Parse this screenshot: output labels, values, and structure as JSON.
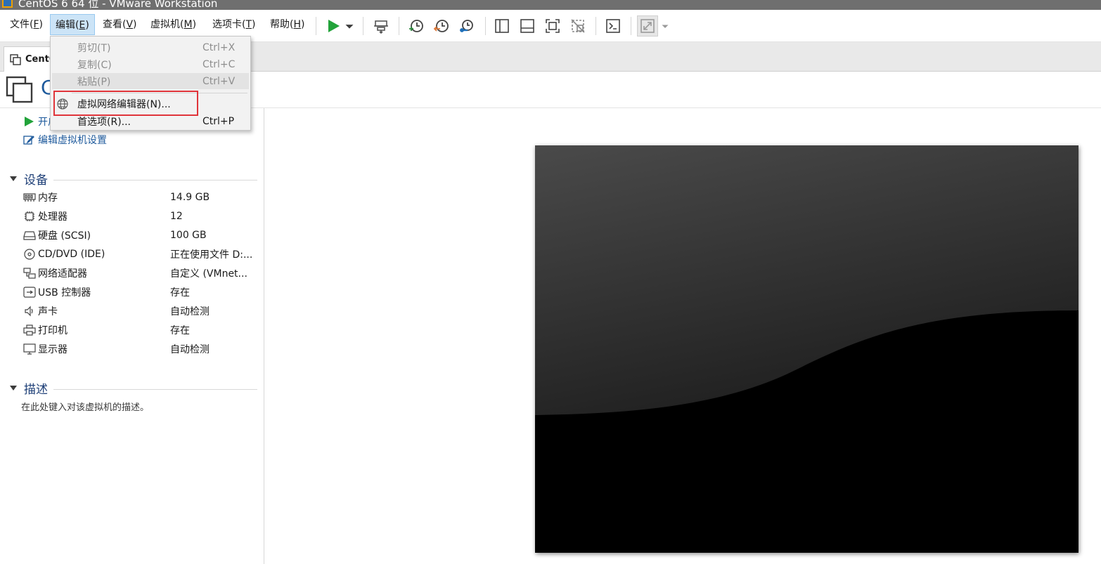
{
  "window": {
    "title": "CentOS 6 64 位 - VMware Workstation"
  },
  "menubar": {
    "items": [
      {
        "label": "文件(",
        "key": "F",
        "suffix": ")"
      },
      {
        "label": "编辑(",
        "key": "E",
        "suffix": ")"
      },
      {
        "label": "查看(",
        "key": "V",
        "suffix": ")"
      },
      {
        "label": "虚拟机(",
        "key": "M",
        "suffix": ")"
      },
      {
        "label": "选项卡(",
        "key": "T",
        "suffix": ")"
      },
      {
        "label": "帮助(",
        "key": "H",
        "suffix": ")"
      }
    ]
  },
  "toolbar": {
    "icons": [
      "play-icon",
      "dropdown-arrow-icon",
      "send-ctrl-alt-del-icon",
      "snapshot-take-icon",
      "snapshot-revert-icon",
      "snapshot-manager-icon",
      "sidebar-view-icon",
      "thumbnail-bar-icon",
      "fullscreen-icon",
      "unity-icon",
      "console-icon",
      "stretch-icon",
      "stretch-dropdown-icon"
    ]
  },
  "tab": {
    "label": "CentO"
  },
  "vm_header": {
    "name": "C"
  },
  "actions": {
    "power_on": "开启",
    "edit_settings": "编辑虚拟机设置"
  },
  "devices": {
    "title": "设备",
    "items": [
      {
        "icon": "memory-icon",
        "name": "内存",
        "value": "14.9 GB"
      },
      {
        "icon": "processor-icon",
        "name": "处理器",
        "value": "12"
      },
      {
        "icon": "harddisk-icon",
        "name": "硬盘 (SCSI)",
        "value": "100 GB"
      },
      {
        "icon": "cd-dvd-icon",
        "name": "CD/DVD (IDE)",
        "value": "正在使用文件 D:..."
      },
      {
        "icon": "network-adapter-icon",
        "name": "网络适配器",
        "value": "自定义 (VMnet..."
      },
      {
        "icon": "usb-icon",
        "name": "USB 控制器",
        "value": "存在"
      },
      {
        "icon": "sound-icon",
        "name": "声卡",
        "value": "自动检测"
      },
      {
        "icon": "printer-icon",
        "name": "打印机",
        "value": "存在"
      },
      {
        "icon": "display-icon",
        "name": "显示器",
        "value": "自动检测"
      }
    ]
  },
  "description": {
    "title": "描述",
    "placeholder": "在此处键入对该虚拟机的描述。"
  },
  "edit_menu": {
    "items": [
      {
        "label": "剪切(T)",
        "shortcut": "Ctrl+X",
        "enabled": false
      },
      {
        "label": "复制(C)",
        "shortcut": "Ctrl+C",
        "enabled": false
      },
      {
        "label": "粘贴(P)",
        "shortcut": "Ctrl+V",
        "enabled": false
      },
      {
        "label": "虚拟网络编辑器(N)...",
        "shortcut": "",
        "enabled": true,
        "icon": "globe-icon"
      },
      {
        "label": "首选项(R)...",
        "shortcut": "Ctrl+P",
        "enabled": true
      }
    ]
  },
  "colors": {
    "accent_blue": "#1e5a9c",
    "menu_active": "#cce4f7",
    "highlight_box": "#e0343a",
    "play_green": "#22a33a"
  }
}
